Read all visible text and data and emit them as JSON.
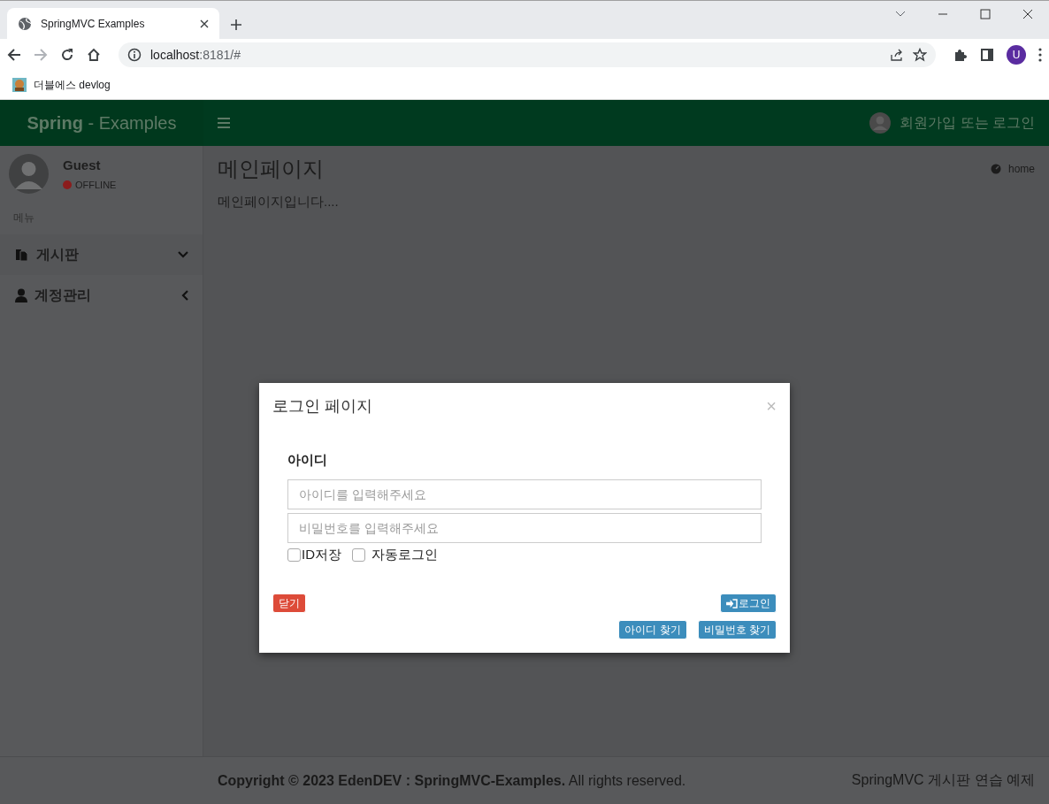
{
  "browser": {
    "tab": {
      "title": "SpringMVC Examples",
      "selected": true
    },
    "url_host": "localhost",
    "url_rest": ":8181/#",
    "bookmark": "더블에스 devlog",
    "profile_initial": "U"
  },
  "header": {
    "brand": "**Spring** - Examples",
    "user_link": "회원가입 또는 로그인"
  },
  "sidebar": {
    "user_name": "Guest",
    "status": "OFFLINE",
    "menu_header": "메뉴",
    "items": [
      {
        "label": "게시판",
        "expanded": true
      },
      {
        "label": "계정관리",
        "expanded": false
      }
    ]
  },
  "content": {
    "title": "메인페이지",
    "breadcrumb": "home",
    "text": "메인페이지입니다...."
  },
  "footer": {
    "copyright": "**Copyright © 2023 EdenDEV : SpringMVC-Examples.** All rights reserved.",
    "right": "SpringMVC 게시판 연습 예제"
  },
  "modal": {
    "title": "로그인 페이지",
    "close": "×",
    "label": "아이디",
    "fields": [
      {
        "placeholder": "아이디를 입력해주세요"
      },
      {
        "placeholder": "비밀번호를 입력해주세요"
      }
    ],
    "checkboxes": [
      {
        "label": "ID저장",
        "checked": false
      },
      {
        "label": "자동로그인",
        "checked": false
      }
    ],
    "buttons": [
      {
        "label": "닫기",
        "kind": "danger"
      },
      {
        "label": "로그인",
        "kind": "primary"
      },
      {
        "label": "아이디 찾기",
        "kind": "primary"
      },
      {
        "label": "비밀번호 찾기",
        "kind": "primary"
      }
    ]
  }
}
